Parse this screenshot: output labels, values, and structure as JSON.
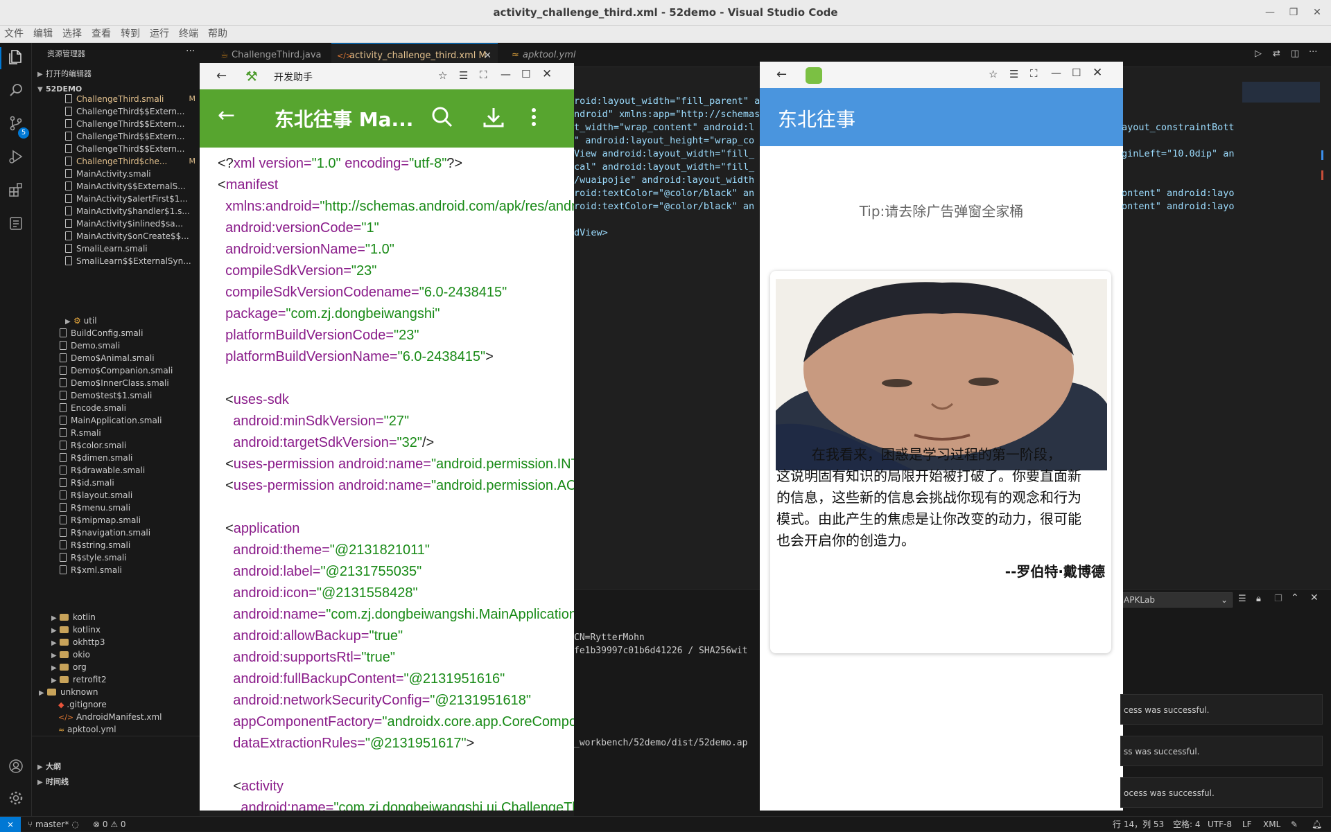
{
  "window": {
    "title": "activity_challenge_third.xml - 52demo - Visual Studio Code"
  },
  "menu": [
    "文件",
    "编辑",
    "选择",
    "查看",
    "转到",
    "运行",
    "终端",
    "帮助"
  ],
  "sidebar": {
    "header": "资源管理器",
    "open_editors": "打开的编辑器",
    "root": "52DEMO",
    "files": [
      {
        "label": "ChallengeThird.smali",
        "badge": "M"
      },
      {
        "label": "ChallengeThird$$Extern...",
        "badge": ""
      },
      {
        "label": "ChallengeThird$$Extern...",
        "badge": ""
      },
      {
        "label": "ChallengeThird$$Extern...",
        "badge": ""
      },
      {
        "label": "ChallengeThird$$Extern...",
        "badge": ""
      },
      {
        "label": "ChallengeThird$che...",
        "badge": "M"
      },
      {
        "label": "MainActivity.smali",
        "badge": ""
      },
      {
        "label": "MainActivity$$ExternalS...",
        "badge": ""
      },
      {
        "label": "MainActivity$alertFirst$1...",
        "badge": ""
      },
      {
        "label": "MainActivity$handler$1.s...",
        "badge": ""
      },
      {
        "label": "MainActivity$inlined$sa...",
        "badge": ""
      },
      {
        "label": "MainActivity$onCreate$$...",
        "badge": ""
      },
      {
        "label": "SmaliLearn.smali",
        "badge": ""
      },
      {
        "label": "SmaliLearn$$ExternalSyn...",
        "badge": ""
      }
    ],
    "util": "util",
    "files2": [
      "BuildConfig.smali",
      "Demo.smali",
      "Demo$Animal.smali",
      "Demo$Companion.smali",
      "Demo$InnerClass.smali",
      "Demo$test$1.smali",
      "Encode.smali",
      "MainApplication.smali",
      "R.smali",
      "R$color.smali",
      "R$dimen.smali",
      "R$drawable.smali",
      "R$id.smali",
      "R$layout.smali",
      "R$menu.smali",
      "R$mipmap.smali",
      "R$navigation.smali",
      "R$string.smali",
      "R$style.smali",
      "R$xml.smali"
    ],
    "folders": [
      "kotlin",
      "kotlinx",
      "okhttp3",
      "okio",
      "org",
      "retrofit2"
    ],
    "unknown": "unknown",
    "root_files": [
      ".gitignore",
      "AndroidManifest.xml",
      "apktool.yml"
    ],
    "outline": "大纲",
    "timeline": "时间线"
  },
  "tabs": [
    {
      "label": "ChallengeThird.java"
    },
    {
      "label": "activity_challenge_third.xml",
      "badge": "M"
    },
    {
      "label": "apktool.yml"
    }
  ],
  "code_lines": [
    "roid:layout_width=\"fill_parent\" an",
    "ndroid\" xmlns:app=\"http://schemas",
    "t_width=\"wrap_content\" android:l",
    "\" android:layout_height=\"wrap_co",
    "View android:layout_width=\"fill_",
    "cal\" android:layout_width=\"fill_",
    "/wuaipojie\" android:layout_width",
    "roid:textColor=\"@color/black\" an",
    "roid:textColor=\"@color/black\" an",
    "",
    "dView>"
  ],
  "code_lines_right": [
    "",
    "",
    "ayout_constraintBott",
    "",
    "ginLeft=\"10.0dip\" an",
    "",
    "",
    "ontent\" android:layo",
    "ontent\" android:layo"
  ],
  "panel": {
    "dropdown": "APKLab"
  },
  "terminal_lines": [
    "CN=RytterMohn",
    "fe1b39997c01b6d41226 / SHA256wit",
    "",
    "",
    "",
    "",
    "",
    "",
    "_workbench/52demo/dist/52demo.ap"
  ],
  "notifications": [
    "cess was successful.",
    "ss was successful.",
    "ocess was successful."
  ],
  "status": {
    "branch": "master*",
    "problems": "⊗ 0 ⚠ 0",
    "position": "行 14，列 53",
    "spaces": "空格: 4",
    "encoding": "UTF-8",
    "eol": "LF",
    "language": "XML"
  },
  "phone1": {
    "window_title": "开发助手",
    "app_title": "东北往事 Ma...",
    "xml": [
      [
        [
          "pun",
          "<?"
        ],
        [
          "tag",
          "xml"
        ],
        [
          "attr",
          " version="
        ],
        [
          "val",
          "\"1.0\""
        ],
        [
          "attr",
          " encoding="
        ],
        [
          "val",
          "\"utf-8\""
        ],
        [
          "pun",
          "?>"
        ]
      ],
      [
        [
          "pun",
          "<"
        ],
        [
          "tag",
          "manifest"
        ]
      ],
      [
        [
          "pun",
          "  "
        ],
        [
          "attr",
          "xmlns:android="
        ],
        [
          "val",
          "\"http://schemas.android.com/apk/res/android\""
        ]
      ],
      [
        [
          "pun",
          "  "
        ],
        [
          "attr",
          "android:versionCode="
        ],
        [
          "val",
          "\"1\""
        ]
      ],
      [
        [
          "pun",
          "  "
        ],
        [
          "attr",
          "android:versionName="
        ],
        [
          "val",
          "\"1.0\""
        ]
      ],
      [
        [
          "pun",
          "  "
        ],
        [
          "attr",
          "compileSdkVersion="
        ],
        [
          "val",
          "\"23\""
        ]
      ],
      [
        [
          "pun",
          "  "
        ],
        [
          "attr",
          "compileSdkVersionCodename="
        ],
        [
          "val",
          "\"6.0-2438415\""
        ]
      ],
      [
        [
          "pun",
          "  "
        ],
        [
          "attr",
          "package="
        ],
        [
          "val",
          "\"com.zj.dongbeiwangshi\""
        ]
      ],
      [
        [
          "pun",
          "  "
        ],
        [
          "attr",
          "platformBuildVersionCode="
        ],
        [
          "val",
          "\"23\""
        ]
      ],
      [
        [
          "pun",
          "  "
        ],
        [
          "attr",
          "platformBuildVersionName="
        ],
        [
          "val",
          "\"6.0-2438415\""
        ],
        [
          "pun",
          ">"
        ]
      ],
      [],
      [
        [
          "pun",
          "  <"
        ],
        [
          "tag",
          "uses-sdk"
        ]
      ],
      [
        [
          "pun",
          "    "
        ],
        [
          "attr",
          "android:minSdkVersion="
        ],
        [
          "val",
          "\"27\""
        ]
      ],
      [
        [
          "pun",
          "    "
        ],
        [
          "attr",
          "android:targetSdkVersion="
        ],
        [
          "val",
          "\"32\""
        ],
        [
          "pun",
          "/>"
        ]
      ],
      [
        [
          "pun",
          "  <"
        ],
        [
          "tag",
          "uses-permission"
        ],
        [
          "attr",
          " android:name="
        ],
        [
          "val",
          "\"android.permission.INTERNET\""
        ]
      ],
      [
        [
          "pun",
          "  <"
        ],
        [
          "tag",
          "uses-permission"
        ],
        [
          "attr",
          " android:name="
        ],
        [
          "val",
          "\"android.permission.ACCESS\""
        ]
      ],
      [],
      [
        [
          "pun",
          "  <"
        ],
        [
          "tag",
          "application"
        ]
      ],
      [
        [
          "pun",
          "    "
        ],
        [
          "attr",
          "android:theme="
        ],
        [
          "val",
          "\"@2131821011\""
        ]
      ],
      [
        [
          "pun",
          "    "
        ],
        [
          "attr",
          "android:label="
        ],
        [
          "val",
          "\"@2131755035\""
        ]
      ],
      [
        [
          "pun",
          "    "
        ],
        [
          "attr",
          "android:icon="
        ],
        [
          "val",
          "\"@2131558428\""
        ]
      ],
      [
        [
          "pun",
          "    "
        ],
        [
          "attr",
          "android:name="
        ],
        [
          "val",
          "\"com.zj.dongbeiwangshi.MainApplication\""
        ]
      ],
      [
        [
          "pun",
          "    "
        ],
        [
          "attr",
          "android:allowBackup="
        ],
        [
          "val",
          "\"true\""
        ]
      ],
      [
        [
          "pun",
          "    "
        ],
        [
          "attr",
          "android:supportsRtl="
        ],
        [
          "val",
          "\"true\""
        ]
      ],
      [
        [
          "pun",
          "    "
        ],
        [
          "attr",
          "android:fullBackupContent="
        ],
        [
          "val",
          "\"@2131951616\""
        ]
      ],
      [
        [
          "pun",
          "    "
        ],
        [
          "attr",
          "android:networkSecurityConfig="
        ],
        [
          "val",
          "\"@2131951618\""
        ]
      ],
      [
        [
          "pun",
          "    "
        ],
        [
          "attr",
          "appComponentFactory="
        ],
        [
          "val",
          "\"androidx.core.app.CoreComponentFactory\""
        ]
      ],
      [
        [
          "pun",
          "    "
        ],
        [
          "attr",
          "dataExtractionRules="
        ],
        [
          "val",
          "\"@2131951617\""
        ],
        [
          "pun",
          ">"
        ]
      ],
      [],
      [
        [
          "pun",
          "    <"
        ],
        [
          "tag",
          "activity"
        ]
      ],
      [
        [
          "pun",
          "      "
        ],
        [
          "attr",
          "android:name="
        ],
        [
          "val",
          "\"com.zj.dongbeiwangshi.ui.ChallengeThird\""
        ]
      ]
    ]
  },
  "phone2": {
    "app_title": "东北往事",
    "tip": "Tip:请去除广告弹窗全家桶",
    "quote_lines": [
      "        在我看来，困惑是学习过程的第一阶段，",
      "这说明固有知识的局限开始被打破了。你要直面新",
      "的信息，这些新的信息会挑战你现有的观念和行为",
      "模式。由此产生的焦虑是让你改变的动力，很可能",
      "也会开启你的创造力。"
    ],
    "author": "--罗伯特·戴博德"
  }
}
